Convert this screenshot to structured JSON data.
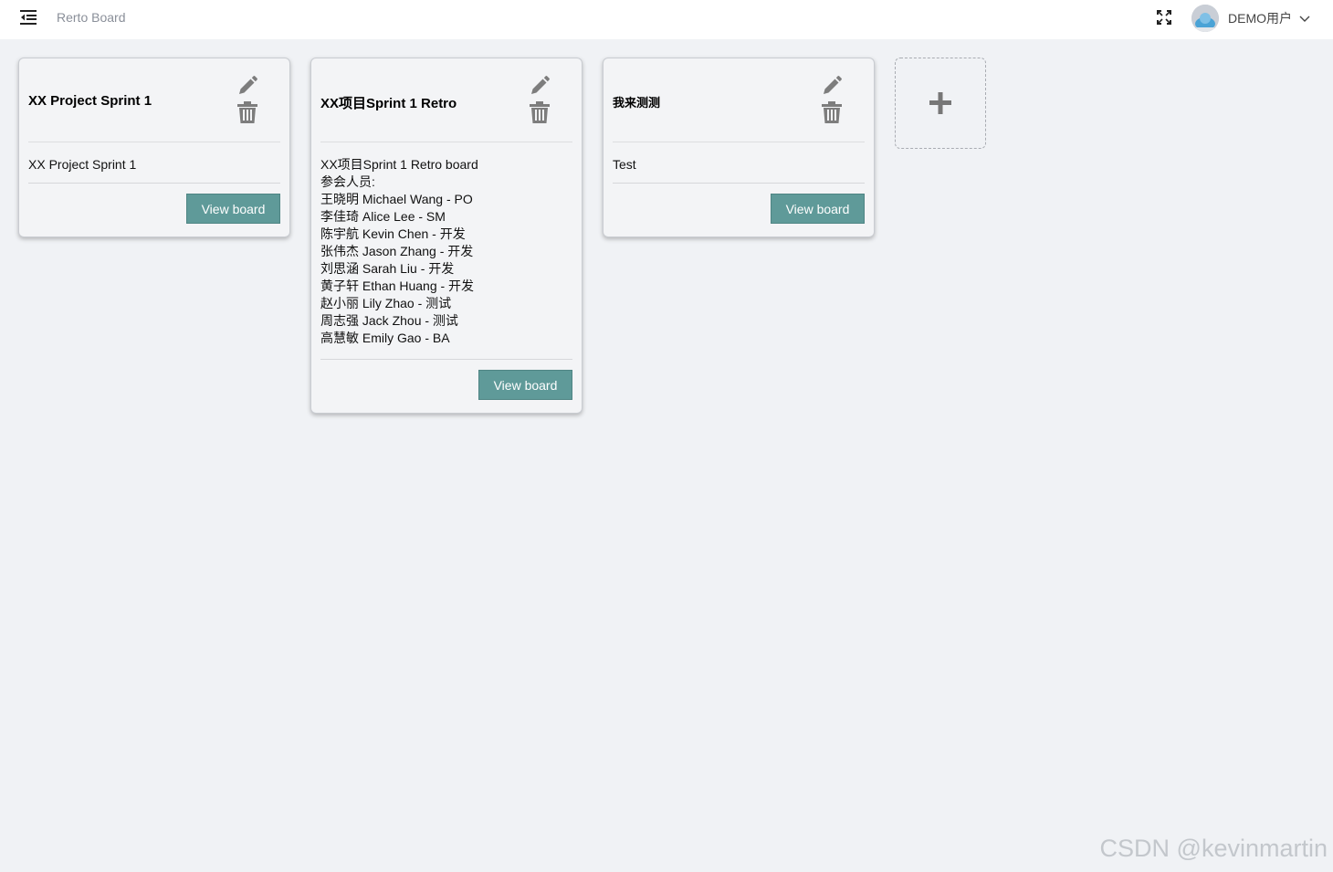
{
  "header": {
    "app_title": "Rerto Board",
    "user_name": "DEMO用户",
    "icons": [
      "menu-fold-icon",
      "fullscreen-icon",
      "avatar",
      "chevron-down-icon"
    ]
  },
  "boards": [
    {
      "title": "XX Project Sprint 1",
      "description_lines": [
        "XX Project Sprint 1"
      ],
      "view_label": "View board"
    },
    {
      "title": "XX项目Sprint 1 Retro",
      "description_lines": [
        "XX项目Sprint 1 Retro board",
        "参会人员:",
        "王晓明 Michael Wang - PO",
        "李佳琦 Alice Lee - SM",
        "陈宇航 Kevin Chen - 开发",
        "张伟杰 Jason Zhang - 开发",
        "刘思涵 Sarah Liu - 开发",
        "黄子轩 Ethan Huang - 开发",
        "赵小丽 Lily Zhao - 测试",
        "周志强 Jack Zhou - 测试",
        "高慧敏 Emily Gao - BA"
      ],
      "view_label": "View board"
    },
    {
      "title": "我来测测",
      "description_lines": [
        "Test"
      ],
      "view_label": "View board"
    }
  ],
  "card_icons": [
    "pencil-icon",
    "trash-icon"
  ],
  "add_board_icon": "plus-icon",
  "watermark": "CSDN @kevinmartin",
  "colors": {
    "page_background": "#f0f2f5",
    "button": "#5f9a99",
    "icon": "#7d7d7d"
  }
}
